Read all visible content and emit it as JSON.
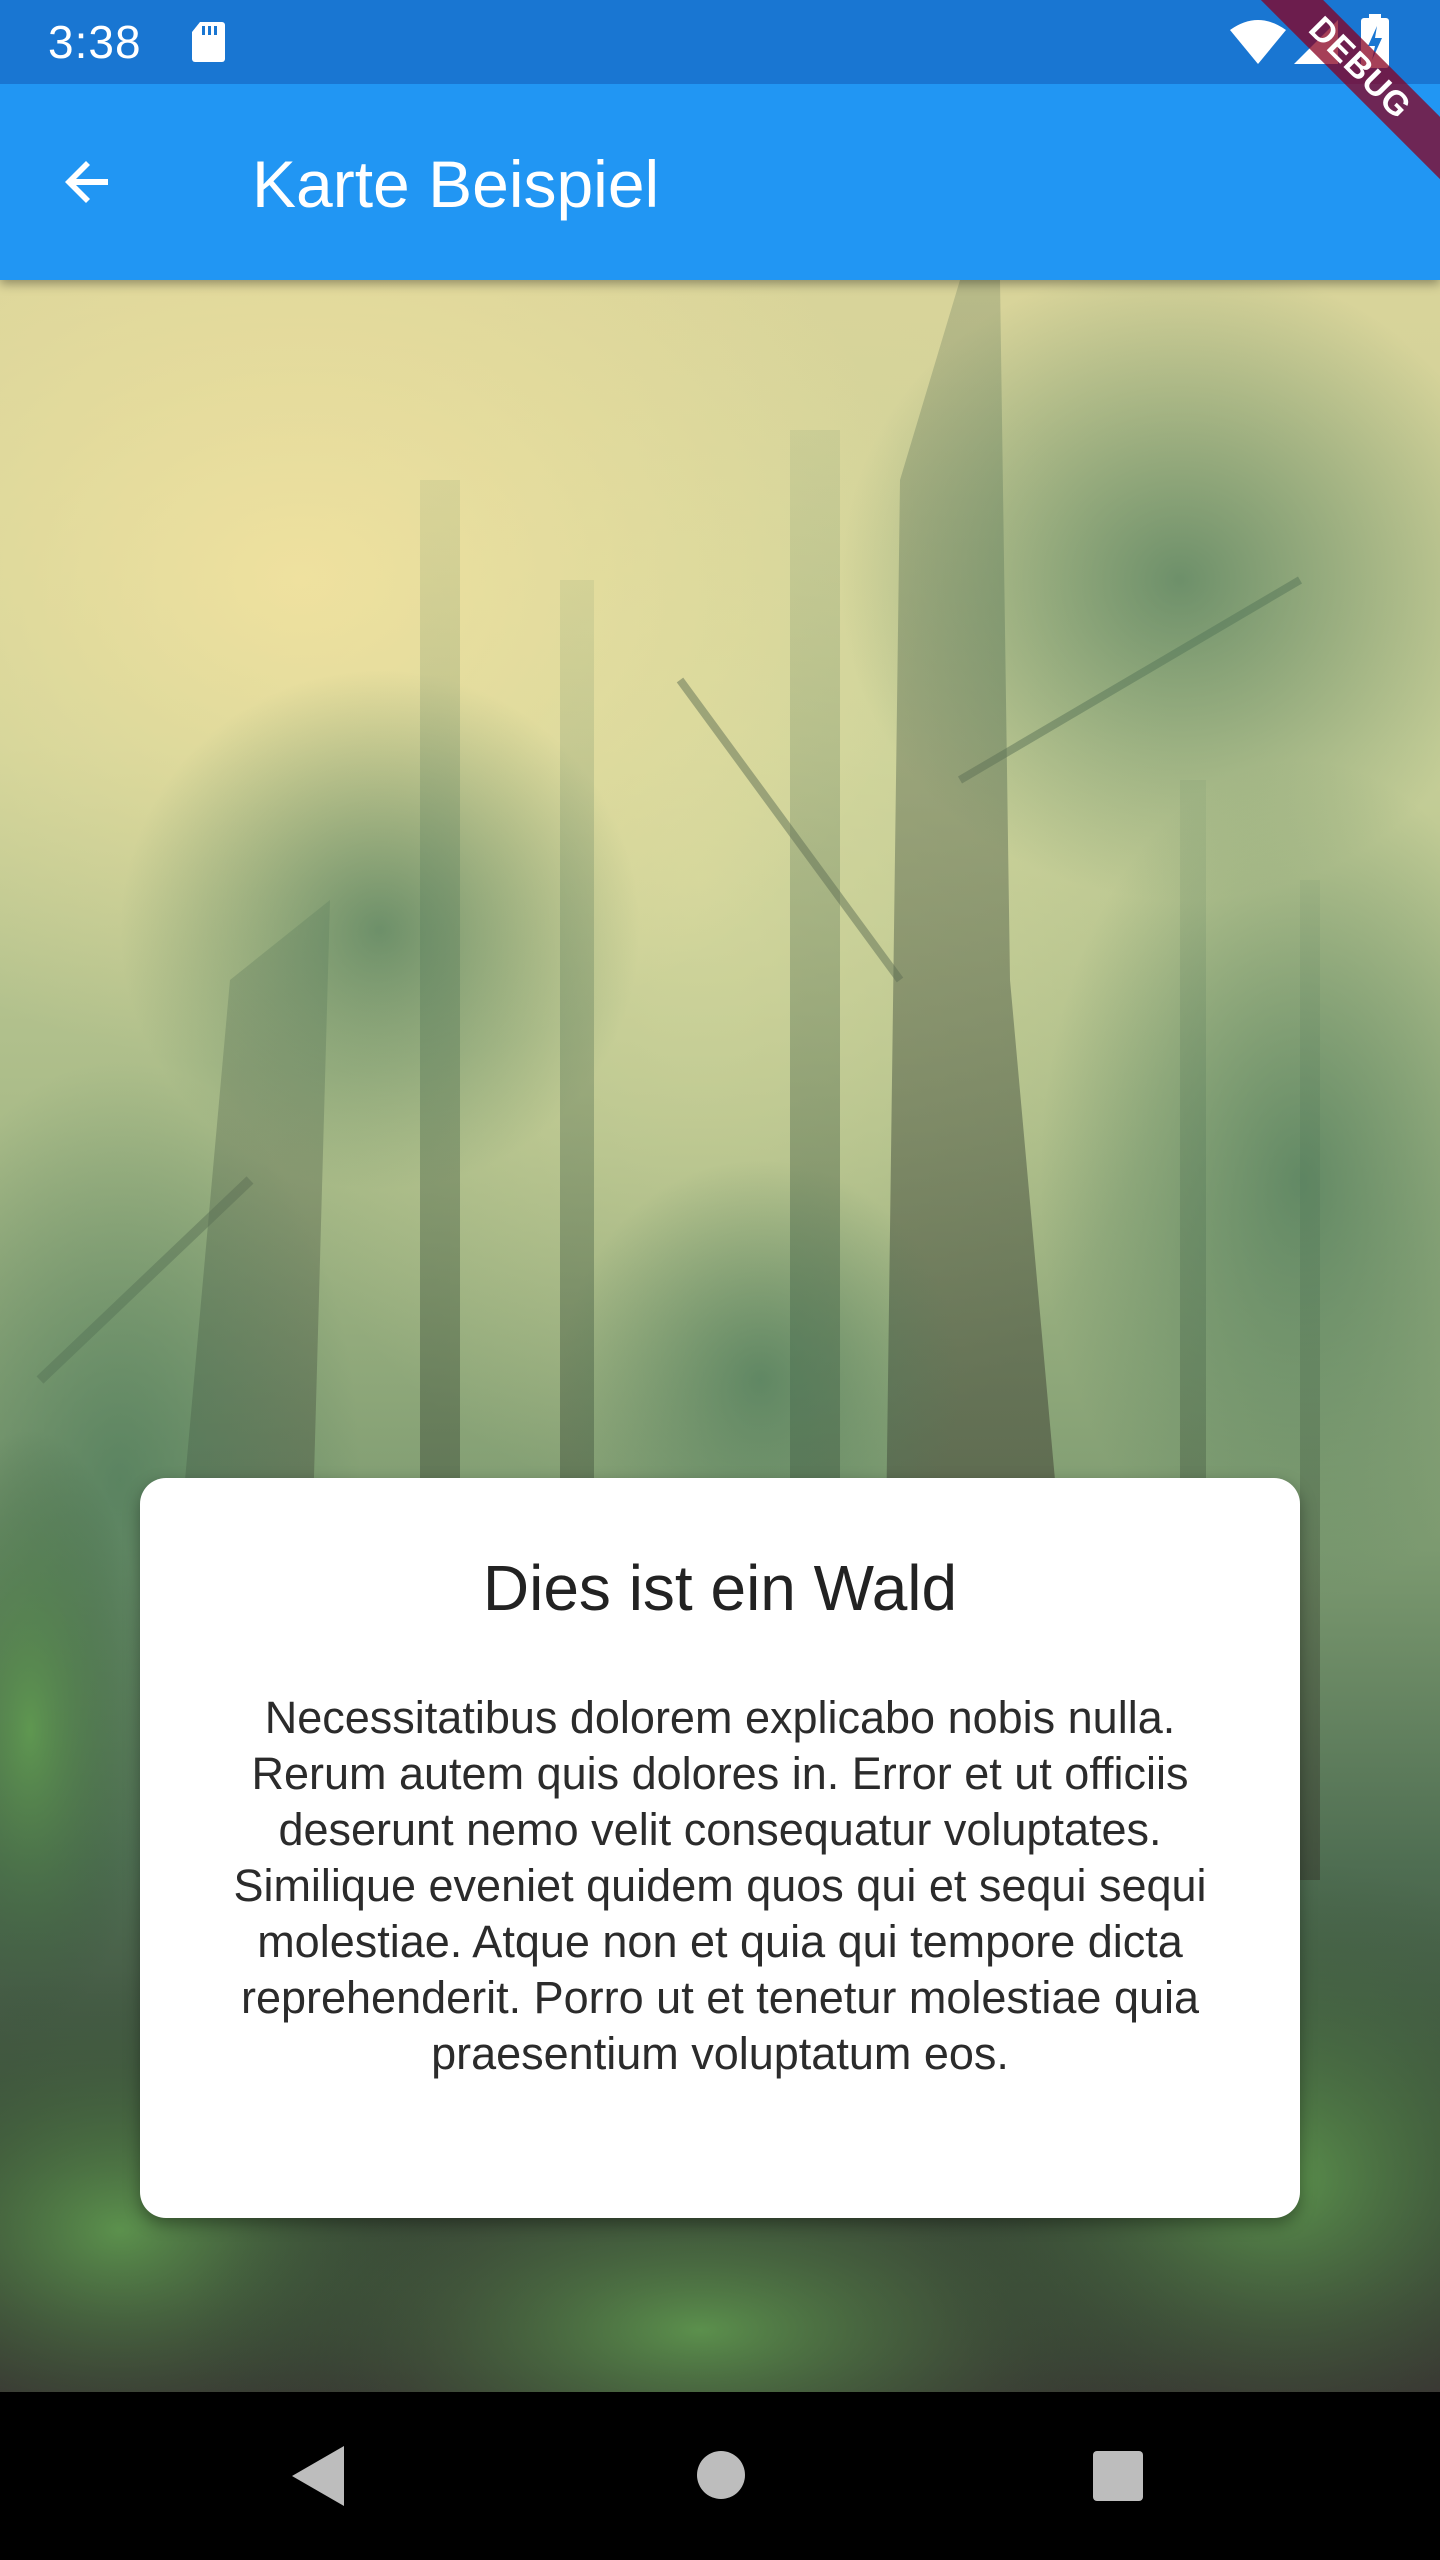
{
  "status_bar": {
    "time": "3:38",
    "icons": [
      "sd-card-icon",
      "wifi-icon",
      "signal-icon",
      "battery-charging-icon"
    ]
  },
  "app_bar": {
    "title": "Karte Beispiel",
    "back_icon": "arrow-back-icon",
    "color": "#2196F3"
  },
  "debug_banner": {
    "label": "DEBUG"
  },
  "card": {
    "title": "Dies ist ein Wald",
    "body": "Necessitatibus dolorem explicabo nobis nulla. Rerum autem quis dolores in. Error et ut officiis deserunt nemo velit consequatur voluptates. Similique eveniet quidem quos qui et sequi sequi molestiae. Atque non et quia qui tempore dicta reprehenderit. Porro ut et tenetur molestiae quia praesentium voluptatum eos."
  },
  "nav_bar": {
    "icons": [
      "nav-back-icon",
      "nav-home-icon",
      "nav-recents-icon"
    ]
  },
  "colors": {
    "status_bar": "#1976D2",
    "app_bar": "#2196F3",
    "card": "#FFFFFF",
    "nav_bar": "#000000"
  }
}
